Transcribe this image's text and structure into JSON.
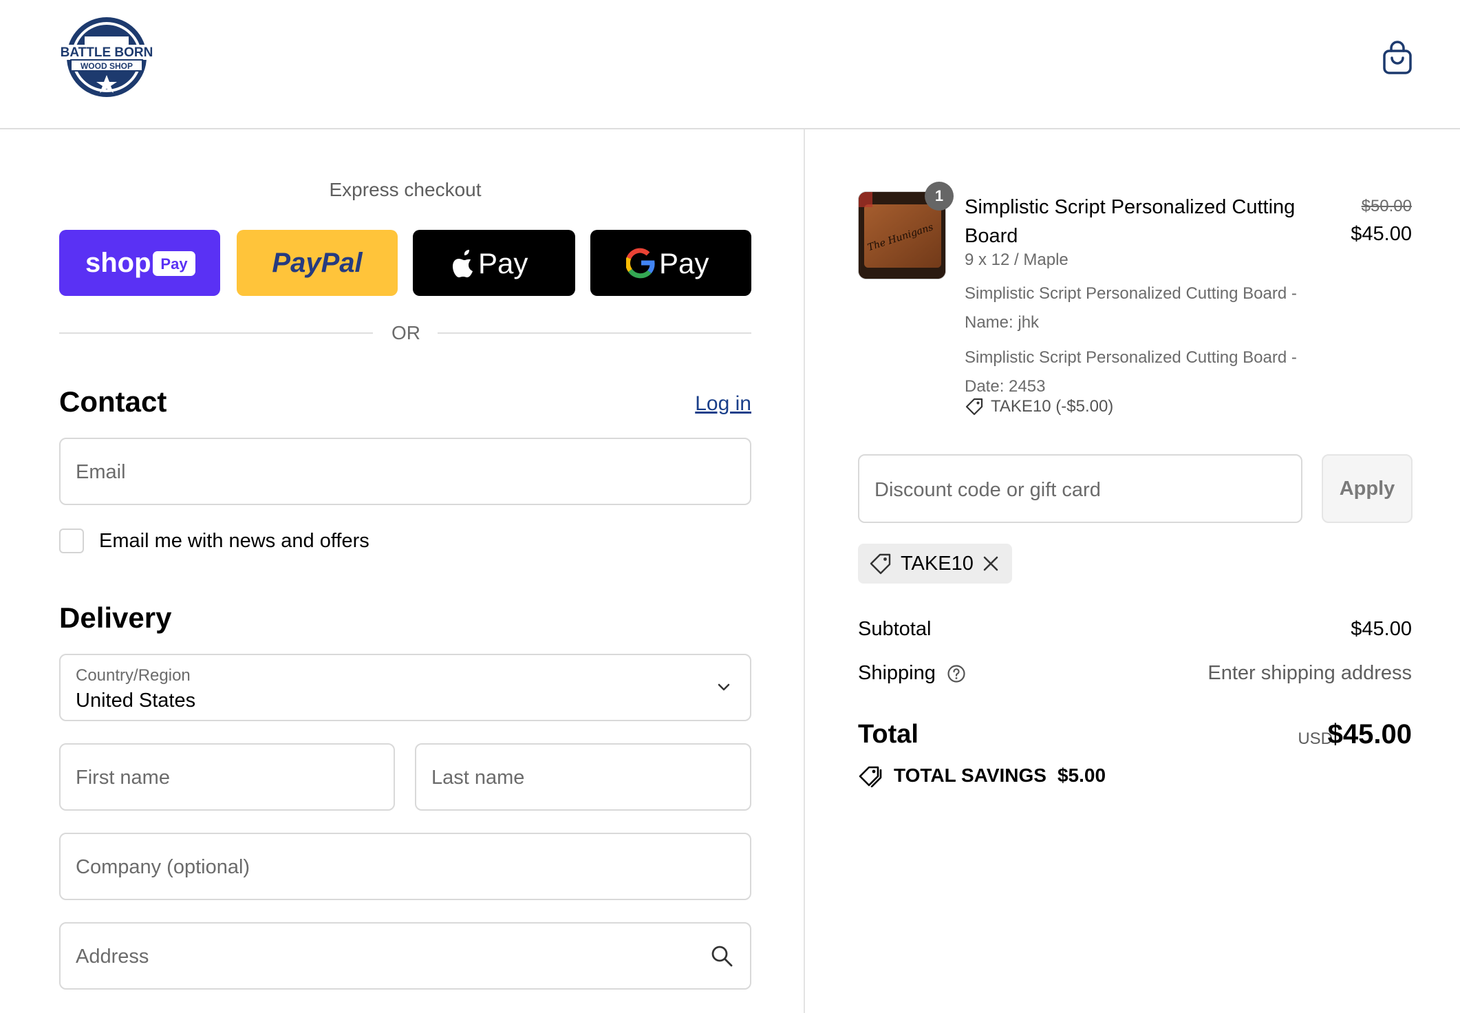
{
  "brand": {
    "logo_line1": "BATTLE BORN",
    "logo_line2": "WOOD SHOP"
  },
  "header": {
    "cart_icon": "shopping-bag-icon"
  },
  "express_checkout": {
    "title": "Express checkout",
    "buttons": [
      {
        "name": "Shop Pay",
        "brand_text": "shop",
        "badge_text": "Pay",
        "color": "#5a31f4"
      },
      {
        "name": "PayPal",
        "brand_text": "PayPal",
        "color": "#ffc43a"
      },
      {
        "name": "Apple Pay",
        "brand_text": "Pay",
        "color": "#000000"
      },
      {
        "name": "Google Pay",
        "brand_text": "Pay",
        "color": "#000000"
      }
    ],
    "or_text": "OR"
  },
  "contact": {
    "title": "Contact",
    "login_link": "Log in",
    "email_placeholder": "Email",
    "newsletter_label": "Email me with news and offers",
    "newsletter_checked": false
  },
  "delivery": {
    "title": "Delivery",
    "country_label": "Country/Region",
    "country_value": "United States",
    "first_name_placeholder": "First name",
    "last_name_placeholder": "Last name",
    "company_placeholder": "Company (optional)",
    "address_placeholder": "Address"
  },
  "order": {
    "item": {
      "quantity": "1",
      "title": "Simplistic Script Personalized Cutting Board",
      "variant": "9 x 12 / Maple",
      "option1": "Simplistic Script Personalized Cutting Board - Name: jhk",
      "option2": "Simplistic Script Personalized Cutting Board - Date: 2453",
      "discount": "TAKE10 (-$5.00)",
      "price_original": "$50.00",
      "price": "$45.00",
      "image_text": "The Hunigans"
    },
    "discount_placeholder": "Discount code or gift card",
    "apply_label": "Apply",
    "applied_code": "TAKE10",
    "subtotal_label": "Subtotal",
    "subtotal_value": "$45.00",
    "shipping_label": "Shipping",
    "shipping_value": "Enter shipping address",
    "total_label": "Total",
    "total_currency": "USD",
    "total_value": "$45.00",
    "savings_label": "TOTAL SAVINGS",
    "savings_value": "$5.00"
  },
  "colors": {
    "accent_link": "#1a3f8a",
    "logo_navy": "#1d3a6e",
    "border": "#d9d9d9"
  }
}
